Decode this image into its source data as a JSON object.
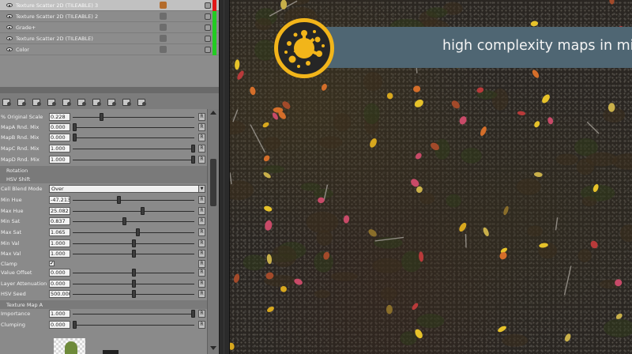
{
  "layers": [
    {
      "name": "Texture Scatter 2D (TILEABLE) 3",
      "selected": true,
      "status_color": "#e01818"
    },
    {
      "name": "Texture Scatter 2D (TILEABLE) 2",
      "selected": false,
      "status_color": "#22cc22"
    },
    {
      "name": "Grade+",
      "selected": false,
      "status_color": "#22cc22"
    },
    {
      "name": "Texture Scatter 2D (TILEABLE)",
      "selected": false,
      "status_color": "#22cc22"
    },
    {
      "name": "Color",
      "selected": false,
      "status_color": "#22cc22"
    }
  ],
  "toolbar": {
    "icons": [
      "add-layer-icon",
      "duplicate-layer-icon",
      "merge-icon",
      "brush-icon",
      "list-add-icon",
      "image-add-icon",
      "gradient-icon",
      "filter-icon",
      "group-icon",
      "grid-icon"
    ]
  },
  "params": {
    "original_scale": {
      "label": "% Original Scale",
      "value": "0.228",
      "level": 0.228
    },
    "mapa_mix": {
      "label": "MapA Rnd. Mix",
      "value": "0.000",
      "level": 0.0
    },
    "mapb_mix": {
      "label": "MapB Rnd. Mix",
      "value": "0.000",
      "level": 0.0
    },
    "mapc_mix": {
      "label": "MapC Rnd. Mix",
      "value": "1.000",
      "level": 1.0
    },
    "mapd_mix": {
      "label": "MapD Rnd. Mix",
      "value": "1.000",
      "level": 1.0
    },
    "section_rotation": "Rotation",
    "section_hsv": "HSV Shift",
    "blend_mode": {
      "label": "Cell Blend Mode",
      "value": "Over"
    },
    "min_hue": {
      "label": "Min Hue",
      "value": "-47.213",
      "level": 0.37
    },
    "max_hue": {
      "label": "Max Hue",
      "value": "25.082",
      "level": 0.57
    },
    "min_sat": {
      "label": "Min Sat",
      "value": "0.837",
      "level": 0.42
    },
    "max_sat": {
      "label": "Max Sat",
      "value": "1.065",
      "level": 0.53
    },
    "min_val": {
      "label": "Min Val",
      "value": "1.000",
      "level": 0.5
    },
    "max_val": {
      "label": "Max Val",
      "value": "1.000",
      "level": 0.5
    },
    "clamp": {
      "label": "Clamp",
      "checked": true
    },
    "value_offset": {
      "label": "Value Offset",
      "value": "0.000",
      "level": 0.5
    },
    "layer_attenuation": {
      "label": "Layer Attenuation",
      "value": "0.000",
      "level": 0.5
    },
    "hsv_seed": {
      "label": "HSV Seed",
      "value": "500.000",
      "level": 0.5
    },
    "section_texture_map": "Texture Map A",
    "importance": {
      "label": "Importance",
      "value": "1.000",
      "level": 1.0
    },
    "clumping": {
      "label": "Clumping",
      "value": "0.000",
      "level": 0.0
    },
    "reset_label": "R"
  },
  "banner": {
    "text": "high complexity maps in minutes",
    "color": "#4f6673",
    "logo_color": "#f2b51a"
  },
  "leaf_colors": [
    "#e6c22a",
    "#d8a81e",
    "#c84a68",
    "#b83a3a",
    "#d46e2a",
    "#c9b04a",
    "#a34a2a",
    "#8a6e2a"
  ]
}
